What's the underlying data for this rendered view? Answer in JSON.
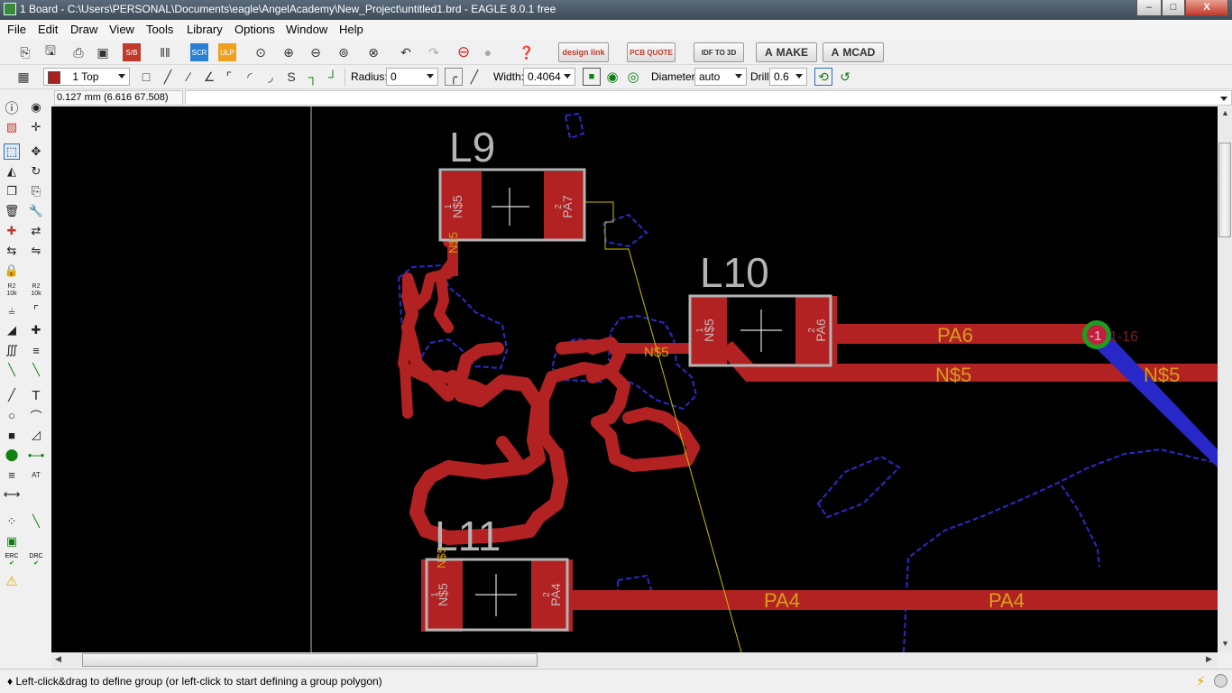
{
  "window": {
    "title": "1 Board - C:\\Users\\PERSONAL\\Documents\\eagle\\AngelAcademy\\New_Project\\untitled1.brd - EAGLE 8.0.1 free",
    "min_label": "–",
    "max_label": "□",
    "close_label": "X"
  },
  "menu": [
    "File",
    "Edit",
    "Draw",
    "View",
    "Tools",
    "Library",
    "Options",
    "Window",
    "Help"
  ],
  "toolbar": {
    "design_link": "design link",
    "pcb_quote": "PCB QUOTE",
    "idf": "IDF TO 3D",
    "make": "MAKE",
    "mcad": "MCAD"
  },
  "params": {
    "layer": "1 Top",
    "layer_color": "#aa1f1f",
    "radius_label": "Radius:",
    "radius_value": "0",
    "width_label": "Width:",
    "width_value": "0.4064",
    "diameter_label": "Diameter:",
    "diameter_value": "auto",
    "drill_label": "Drill:",
    "drill_value": "0.6"
  },
  "coord_display": "0.127 mm (6.616 67.508)",
  "status": "♦ Left-click&drag to define group (or left-click to start defining a group polygon)",
  "left_panel": {
    "erc": "ERC",
    "drc": "DRC",
    "r1": "R2",
    "r1b": "10k",
    "r2": "R2",
    "r2b": "10k"
  },
  "board": {
    "colors": {
      "copper_top": "#b22222",
      "copper_bottom": "#2b2bcc",
      "outline": "#b4b4b4",
      "label": "#d4a017",
      "airwire": "#c8c000",
      "via": "#1e9e1e"
    },
    "components": [
      {
        "name": "L9",
        "pad1": "N$5",
        "pad2": "PA7",
        "pin1": "1",
        "pin2": "2"
      },
      {
        "name": "L10",
        "pad1": "N$5",
        "pad2": "PA6",
        "pin1": "1",
        "pin2": "2"
      },
      {
        "name": "L11",
        "pad1": "N$5",
        "pad2": "PA4",
        "pin1": "1",
        "pin2": "2"
      }
    ],
    "signal_labels": {
      "l9_trace": "N$5",
      "mid_trace": "N$5",
      "pa6_trace": "PA6",
      "n5_trace": "N$5",
      "n5_trace_right": "N$5",
      "pa4_trace": "PA4",
      "pa4_trace_right": "PA4",
      "l11_trace": "N$5",
      "via_label": "1-16",
      "via_pin": "-1"
    }
  }
}
